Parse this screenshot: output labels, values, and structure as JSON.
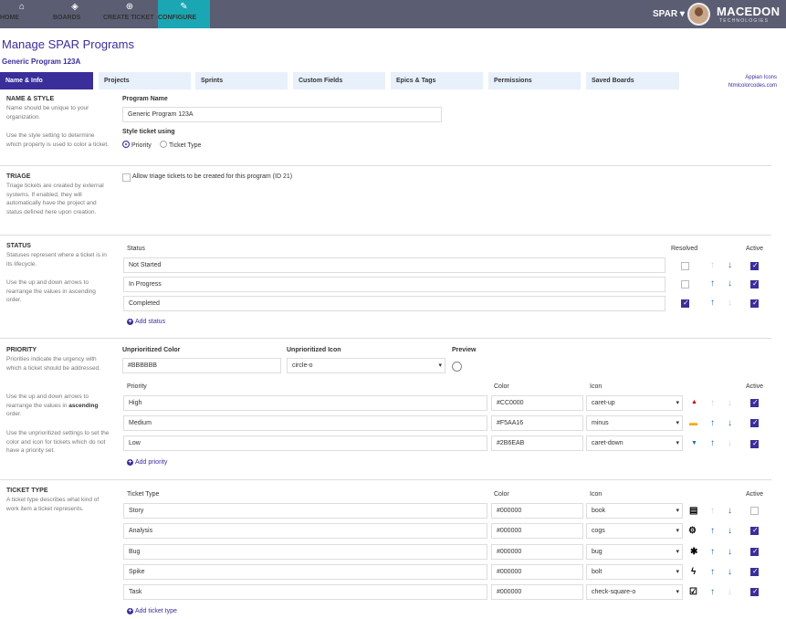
{
  "nav": {
    "home": "HOME",
    "boards": "BOARDS",
    "create": "CREATE TICKET",
    "configure": "CONFIGURE",
    "user_menu": "SPAR ▾",
    "brand": "MACEDON",
    "brand_sub": "TECHNOLOGIES"
  },
  "page": {
    "title": "Manage SPAR Programs",
    "program": "Generic Program 123A"
  },
  "tabs": [
    "Name & Info",
    "Projects",
    "Sprints",
    "Custom Fields",
    "Epics & Tags",
    "Permissions",
    "Saved Boards"
  ],
  "links": {
    "appian": "Appian Icons",
    "html": "htmlcolorcodes.com"
  },
  "name_style": {
    "title": "NAME & STYLE",
    "desc1": "Name should be unique to your organization.",
    "desc2": "Use the style setting to determine which property is used to color a ticket.",
    "program_name_label": "Program Name",
    "program_name_value": "Generic Program 123A",
    "style_label": "Style ticket using",
    "opt_priority": "Priority",
    "opt_type": "Ticket Type"
  },
  "triage": {
    "title": "TRIAGE",
    "desc": "Triage tickets are created by external systems. If enabled, they will automatically have the project and status defined here upon creation.",
    "checkbox_label": "Allow triage tickets to be created for this program (ID 21)"
  },
  "status": {
    "title": "STATUS",
    "desc1": "Statuses represent where a ticket is in its lifecycle.",
    "desc2": "Use the up and down arrows to rearrange the values in ascending order.",
    "col_status": "Status",
    "col_resolved": "Resolved",
    "col_active": "Active",
    "rows": [
      {
        "name": "Not Started",
        "resolved": false,
        "active": true
      },
      {
        "name": "In Progress",
        "resolved": false,
        "active": true
      },
      {
        "name": "Completed",
        "resolved": true,
        "active": true
      }
    ],
    "add": "Add status"
  },
  "priority": {
    "title": "PRIORITY",
    "desc1": "Priorities indicate the urgency with which a ticket should be addressed.",
    "desc2a": "Use the up and down arrows to rearrange the values in ",
    "desc2b": "ascending",
    "desc2c": " order.",
    "desc3": "Use the unprioritized settings to set the color and icon for tickets which do not have a priority set.",
    "unprio_color_label": "Unprioritized Color",
    "unprio_color": "#BBBBBB",
    "unprio_icon_label": "Unprioritized Icon",
    "unprio_icon": "circle-o",
    "preview_label": "Preview",
    "col_priority": "Priority",
    "col_color": "Color",
    "col_icon": "Icon",
    "col_active": "Active",
    "rows": [
      {
        "name": "High",
        "color": "#CC0000",
        "icon": "caret-up",
        "glyph": "▲",
        "active": true
      },
      {
        "name": "Medium",
        "color": "#F5AA16",
        "icon": "minus",
        "glyph": "▬",
        "active": true
      },
      {
        "name": "Low",
        "color": "#2B6EAB",
        "icon": "caret-down",
        "glyph": "▼",
        "active": true
      }
    ],
    "add": "Add priority"
  },
  "ticket_type": {
    "title": "TICKET TYPE",
    "desc": "A ticket type describes what kind of work item a ticket represents.",
    "col_type": "Ticket Type",
    "col_color": "Color",
    "col_icon": "Icon",
    "col_active": "Active",
    "rows": [
      {
        "name": "Story",
        "color": "#000000",
        "icon": "book",
        "glyph": "▤",
        "active": false
      },
      {
        "name": "Analysis",
        "color": "#000000",
        "icon": "cogs",
        "glyph": "⚙",
        "active": true
      },
      {
        "name": "Bug",
        "color": "#000000",
        "icon": "bug",
        "glyph": "✱",
        "active": true
      },
      {
        "name": "Spike",
        "color": "#000000",
        "icon": "bolt",
        "glyph": "ϟ",
        "active": true
      },
      {
        "name": "Task",
        "color": "#000000",
        "icon": "check-square-o",
        "glyph": "☑",
        "active": true
      }
    ],
    "add": "Add ticket type"
  }
}
